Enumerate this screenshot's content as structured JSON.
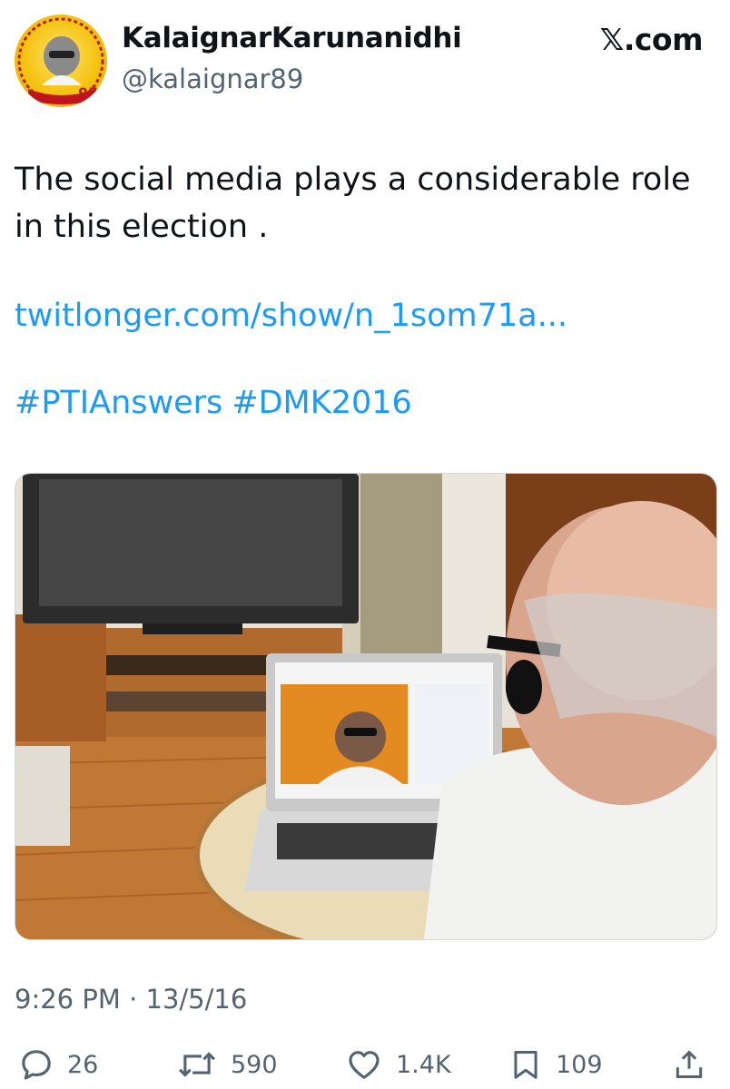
{
  "account": {
    "display_name": "KalaignarKarunanidhi",
    "handle": "@kalaignar89",
    "avatar_badge": "95"
  },
  "brand": "𝕏.com",
  "tweet": {
    "text": "The social media plays a considerable role in this election .",
    "link": "twitlonger.com/show/n_1som71a...",
    "hashtags": [
      "#PTIAnswers",
      "#DMK2016"
    ],
    "timestamp": "9:26 PM · 13/5/16"
  },
  "actions": {
    "replies": "26",
    "retweets": "590",
    "likes": "1.4K",
    "bookmarks": "109"
  },
  "colors": {
    "link": "#1d9bf0",
    "secondary_text": "#536471",
    "primary_text": "#0f1419"
  },
  "icons": [
    "reply-icon",
    "retweet-icon",
    "like-icon",
    "bookmark-icon",
    "share-icon"
  ]
}
